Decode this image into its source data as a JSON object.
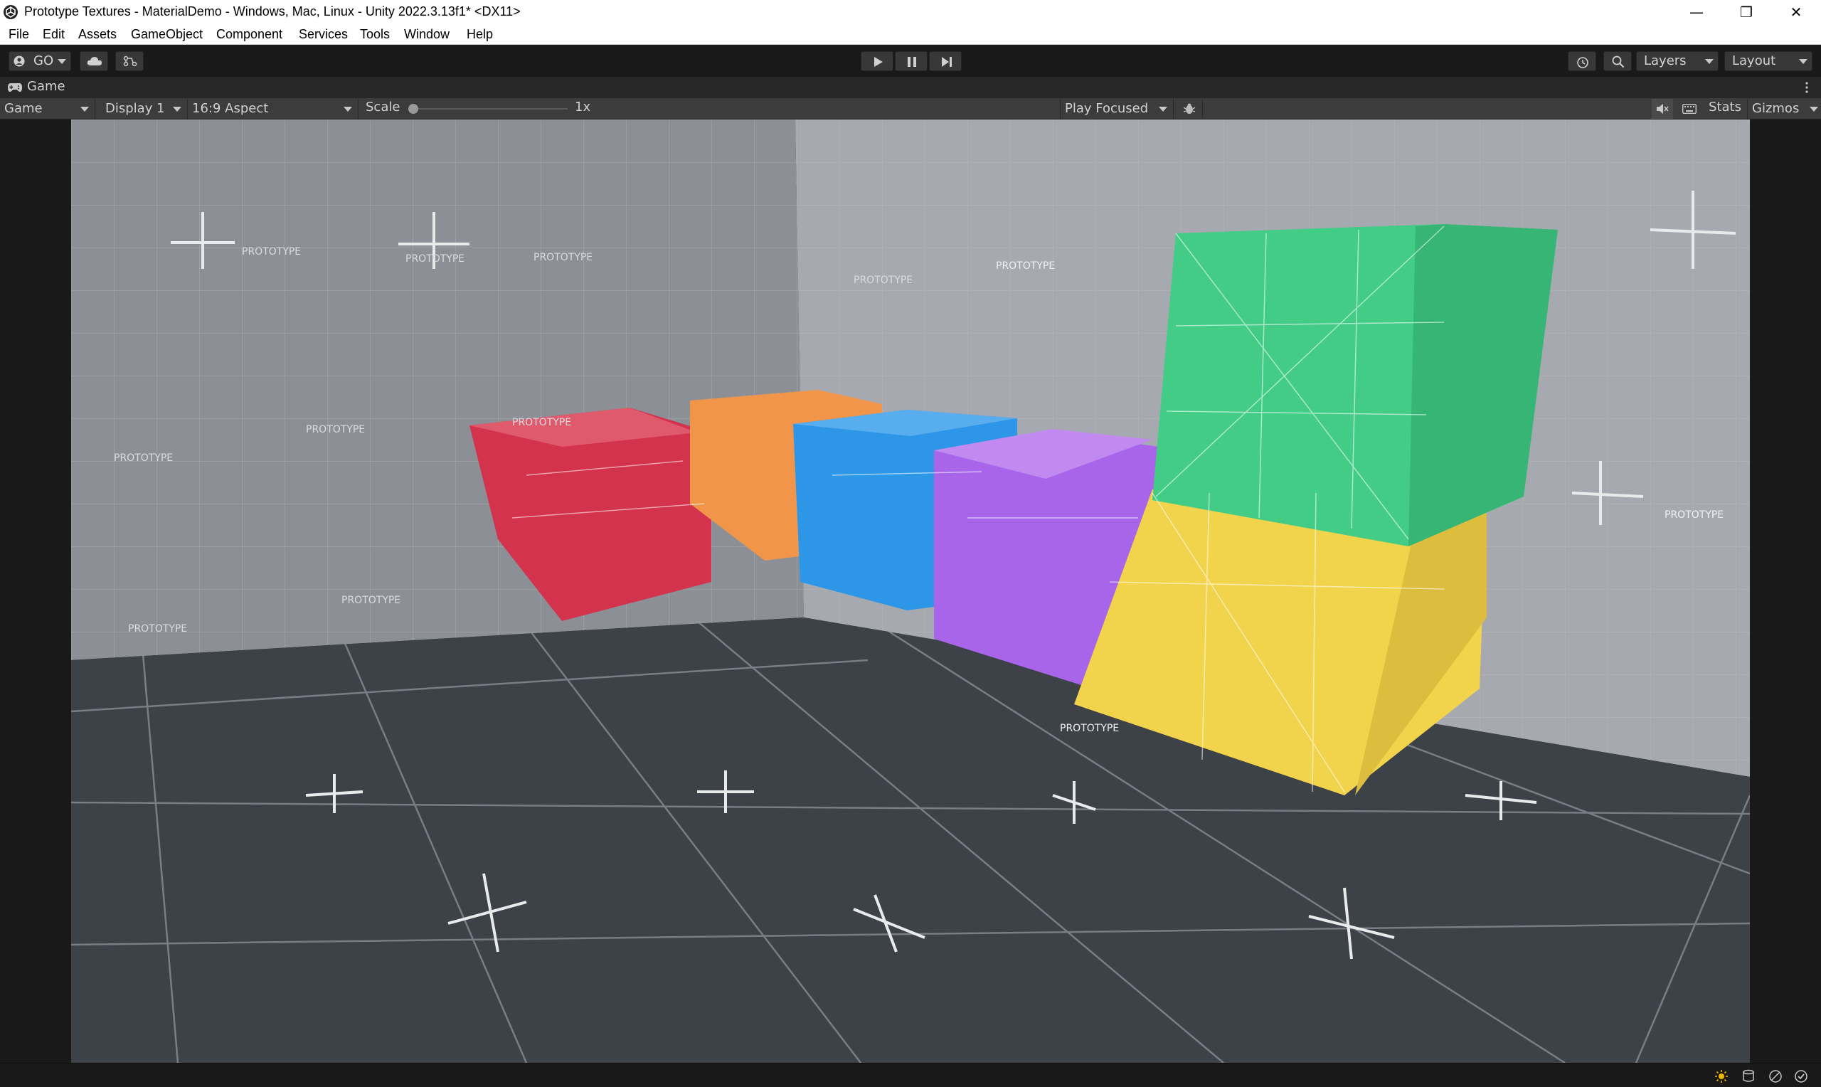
{
  "window": {
    "title": "Prototype Textures - MaterialDemo - Windows, Mac, Linux - Unity 2022.3.13f1* <DX11>",
    "controls": {
      "minimize": "—",
      "maximize": "❐",
      "close": "✕"
    }
  },
  "menu": [
    "File",
    "Edit",
    "Assets",
    "GameObject",
    "Component",
    "Services",
    "Tools",
    "Window",
    "Help"
  ],
  "toolbar": {
    "account_label": "GO",
    "layers_label": "Layers",
    "layout_label": "Layout"
  },
  "game_tab": {
    "label": "Game"
  },
  "game_toolbar": {
    "view_mode": "Game",
    "display": "Display 1",
    "aspect": "16:9 Aspect",
    "scale_label": "Scale",
    "scale_value": "1x",
    "scale_level": 0,
    "play_mode": "Play Focused",
    "stats_label": "Stats",
    "gizmos_label": "Gizmos"
  },
  "scene": {
    "texture_text": "PROTOTYPE",
    "cube_colors": {
      "red": "#d3334d",
      "orange": "#f0954a",
      "blue": "#2e96e6",
      "purple": "#a865ea",
      "green": "#42cc86",
      "yellow": "#f2d34c"
    }
  }
}
